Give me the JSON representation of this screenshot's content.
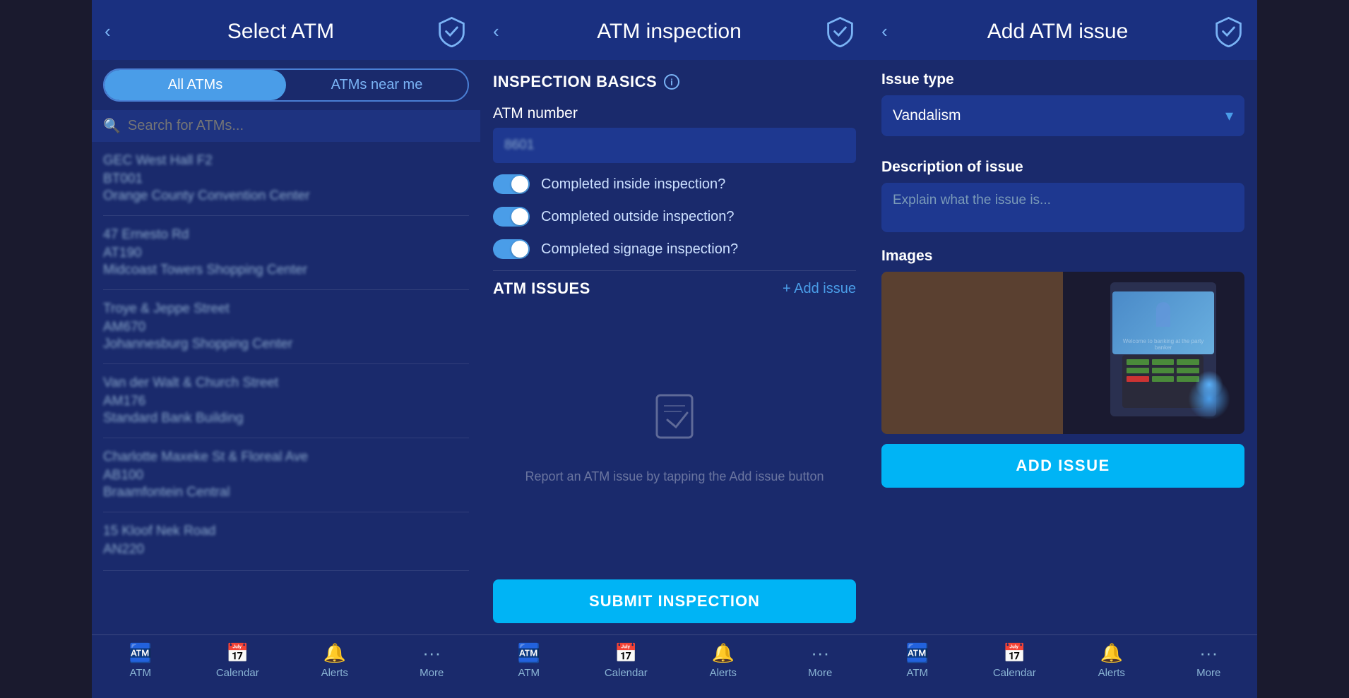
{
  "screen1": {
    "header": {
      "back_label": "‹",
      "title": "Select ATM",
      "logo_alt": "shield-logo"
    },
    "tabs": {
      "all_atms": "All ATMs",
      "atms_near_me": "ATMs near me"
    },
    "search": {
      "placeholder": "Search for ATMs..."
    },
    "atm_list": [
      {
        "name": "GEC West Hall F2",
        "code": "BT001",
        "location": "Orange County Convention Center"
      },
      {
        "name": "47 Ernesto Rd",
        "code": "AT190",
        "location": "Midcoast Towers Shopping Center"
      },
      {
        "name": "Troye & Jeppe Street",
        "code": "AM670",
        "location": "Johannesburg Shopping Center"
      },
      {
        "name": "Van der Walt & Church Street",
        "code": "AM176",
        "location": "Standard Bank Building"
      },
      {
        "name": "Charlotte Maxeke St & Floreal Ave",
        "code": "AB100",
        "location": "Braamfontein Central"
      },
      {
        "name": "15 Kloof Nek Road",
        "code": "AN220",
        "location": ""
      }
    ],
    "nav": {
      "atm": "ATM",
      "calendar": "Calendar",
      "alerts": "Alerts",
      "more": "More"
    }
  },
  "screen2": {
    "header": {
      "back_label": "‹",
      "title": "ATM inspection"
    },
    "inspection_basics": {
      "section_title": "INSPECTION BASICS",
      "atm_number_label": "ATM number",
      "atm_number_value": "8601",
      "toggle1_label": "Completed inside inspection?",
      "toggle2_label": "Completed outside inspection?",
      "toggle3_label": "Completed signage inspection?"
    },
    "atm_issues": {
      "section_title": "ATM ISSUES",
      "add_issue_label": "+ Add issue",
      "empty_text": "Report an ATM issue by\ntapping the Add issue button"
    },
    "submit_btn": "SUBMIT INSPECTION",
    "nav": {
      "atm": "ATM",
      "calendar": "Calendar",
      "alerts": "Alerts",
      "more": "More"
    }
  },
  "screen3": {
    "header": {
      "back_label": "‹",
      "title": "Add ATM issue"
    },
    "issue_type": {
      "label": "Issue type",
      "value": "Vandalism"
    },
    "description": {
      "label": "Description of issue",
      "placeholder": "Explain what the issue is..."
    },
    "images": {
      "label": "Images"
    },
    "add_issue_btn": "ADD ISSUE",
    "nav": {
      "atm": "ATM",
      "calendar": "Calendar",
      "alerts": "Alerts",
      "more": "More"
    }
  }
}
